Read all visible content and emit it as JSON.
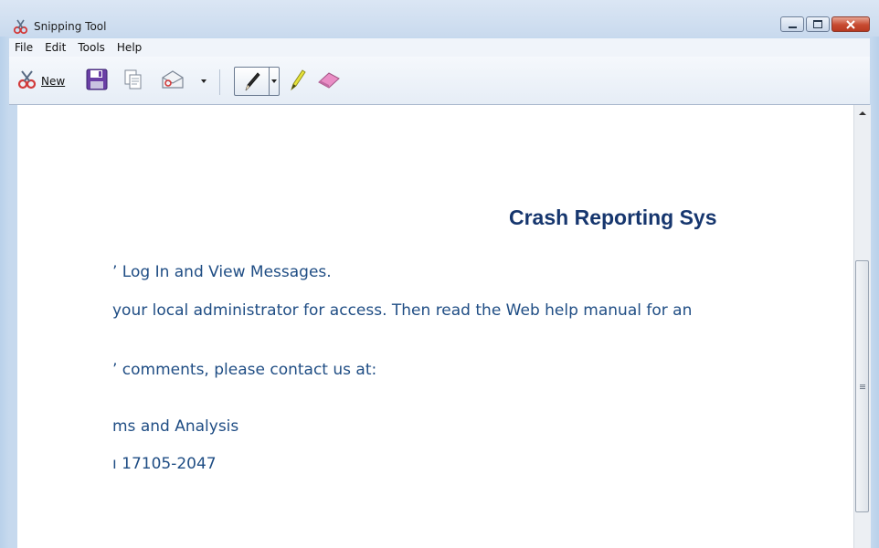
{
  "window": {
    "title": "Snipping Tool",
    "icon": "scissors-icon"
  },
  "menubar": {
    "items": [
      "File",
      "Edit",
      "Tools",
      "Help"
    ]
  },
  "toolbar": {
    "new_label": "New",
    "tools": [
      "new-snip-icon",
      "save-icon",
      "copy-icon",
      "send-snip-icon",
      "pen-icon",
      "highlighter-icon",
      "eraser-icon"
    ]
  },
  "document": {
    "heading": "Crash Reporting Sys",
    "lines": [
      "’ Log In and View Messages.",
      "your local administrator for access. Then read the Web help manual for an",
      "’ comments, please contact us at:",
      "ms and Analysis",
      "ı 17105-2047"
    ]
  },
  "colors": {
    "heading": "#16366e",
    "body_text": "#1f4d84",
    "chrome": "#c6d9ee"
  }
}
